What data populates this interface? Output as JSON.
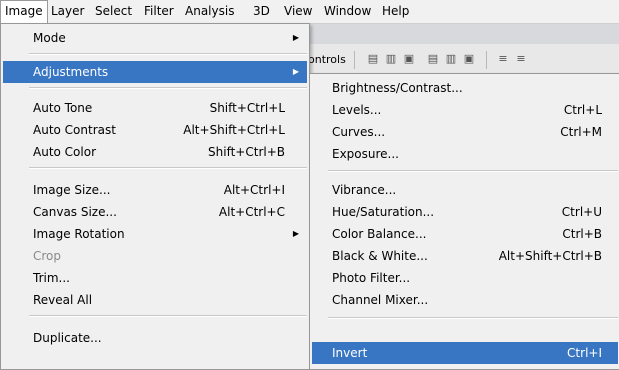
{
  "menubar": {
    "items": [
      "Image",
      "Layer",
      "Select",
      "Filter",
      "Analysis",
      "3D",
      "View",
      "Window",
      "Help"
    ]
  },
  "options_bar": {
    "label": "ontrols"
  },
  "image_menu": {
    "items": [
      {
        "label": "Mode",
        "shortcut": "",
        "submenu": true
      },
      {
        "label": "Adjustments",
        "shortcut": "",
        "submenu": true,
        "highlighted": true
      },
      {
        "label": "Auto Tone",
        "shortcut": "Shift+Ctrl+L"
      },
      {
        "label": "Auto Contrast",
        "shortcut": "Alt+Shift+Ctrl+L"
      },
      {
        "label": "Auto Color",
        "shortcut": "Shift+Ctrl+B"
      },
      {
        "label": "Image Size...",
        "shortcut": "Alt+Ctrl+I"
      },
      {
        "label": "Canvas Size...",
        "shortcut": "Alt+Ctrl+C"
      },
      {
        "label": "Image Rotation",
        "shortcut": "",
        "submenu": true
      },
      {
        "label": "Crop",
        "shortcut": "",
        "disabled": true
      },
      {
        "label": "Trim...",
        "shortcut": ""
      },
      {
        "label": "Reveal All",
        "shortcut": ""
      },
      {
        "label": "Duplicate...",
        "shortcut": ""
      }
    ]
  },
  "adjustments_menu": {
    "items": [
      {
        "label": "Brightness/Contrast...",
        "shortcut": ""
      },
      {
        "label": "Levels...",
        "shortcut": "Ctrl+L"
      },
      {
        "label": "Curves...",
        "shortcut": "Ctrl+M"
      },
      {
        "label": "Exposure...",
        "shortcut": ""
      },
      {
        "label": "Vibrance...",
        "shortcut": ""
      },
      {
        "label": "Hue/Saturation...",
        "shortcut": "Ctrl+U"
      },
      {
        "label": "Color Balance...",
        "shortcut": "Ctrl+B"
      },
      {
        "label": "Black & White...",
        "shortcut": "Alt+Shift+Ctrl+B"
      },
      {
        "label": "Photo Filter...",
        "shortcut": ""
      },
      {
        "label": "Channel Mixer...",
        "shortcut": ""
      },
      {
        "label": "Invert",
        "shortcut": "Ctrl+I",
        "highlighted": true
      }
    ]
  },
  "colors": {
    "highlight": "#3876c4",
    "menu_bg": "#f0f0f0",
    "disabled_text": "#8a8a8a"
  },
  "icons": {
    "submenu_arrow": "triangle-right-icon"
  }
}
